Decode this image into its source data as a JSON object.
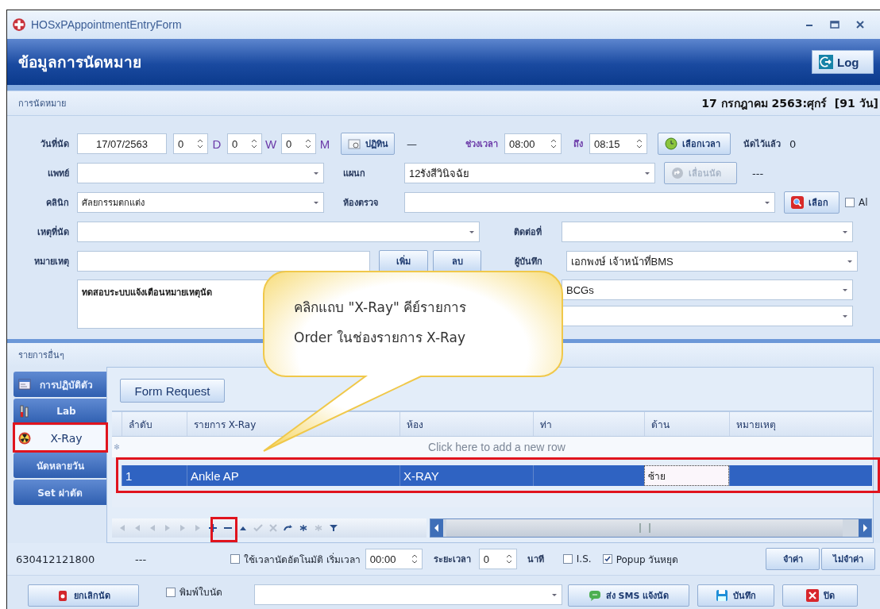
{
  "window": {
    "title": "HOSxPAppointmentEntryForm"
  },
  "header": {
    "title": "ข้อมูลการนัดหมาย",
    "log_button": "Log"
  },
  "appointment": {
    "group_title": "การนัดหมาย",
    "date_summary": "17 กรกฎาคม 2563:ศุกร์  [91 วัน]",
    "date_label": "วันที่นัด",
    "date": "17/07/2563",
    "offsets": [
      {
        "value": "0",
        "unit": "D"
      },
      {
        "value": "0",
        "unit": "W"
      },
      {
        "value": "0",
        "unit": "M"
      }
    ],
    "calendar_button": "ปฏิทิน",
    "dash": "—",
    "time_label": "ช่วงเวลา",
    "time_from": "08:00",
    "to_label": "ถึง",
    "time_to": "08:15",
    "pick_time_button": {
      "label": "เลือกเวลา",
      "disabled": false
    },
    "booked_label": "นัดไว้แล้ว",
    "booked_count": "0",
    "doctor_label": "แพทย์",
    "department_label": "แผนก",
    "department": "12รังสีวินิจฉัย",
    "postpone_button": {
      "label": "เลื่อนนัด",
      "disabled": true
    },
    "postpone_info": "---",
    "clinic_label": "คลินิก",
    "clinic": "ศัลยกรรมตกแต่ง",
    "room_label": "ห้องตรวจ",
    "select_button": "เลือก",
    "all_checkbox": {
      "label": "Al",
      "checked": false
    },
    "reason_label": "เหตุที่นัด",
    "contact_label": "ติดต่อที่",
    "note_label": "หมายเหตุ",
    "add_button": "เพิ่ม",
    "delete_button": "ลบ",
    "recorder_label": "ผู้บันทึก",
    "recorder": "เอกพงษ์ เจ้าหน้าที่BMS",
    "memo": "ทดสอบระบบแจ้งเตือนหมายเหตุนัด",
    "extra_combo": "BCGs"
  },
  "others": {
    "group_title": "รายการอื่นๆ",
    "tabs": [
      {
        "label": "การปฏิบัติตัว",
        "selected": false
      },
      {
        "label": "Lab",
        "selected": false
      },
      {
        "label": "X-Ray",
        "selected": true
      },
      {
        "label": "นัดหลายวัน",
        "selected": false
      },
      {
        "label": "Set ผ่าตัด",
        "selected": false
      }
    ],
    "form_request_button": "Form Request",
    "columns": [
      "ลำดับ",
      "รายการ X-Ray",
      "ห้อง",
      "ท่า",
      "ด้าน",
      "หมายเหตุ"
    ],
    "new_row_marker": "✻",
    "new_row_hint": "Click here to add a new row",
    "rows": [
      {
        "no": "1",
        "item": "Ankle AP",
        "room": "X-RAY",
        "side": "ซ้าย",
        "selected": true
      }
    ]
  },
  "bottom": {
    "hn": "630412121800",
    "hn_info": "---",
    "auto_time": {
      "label": "ใช้เวลานัดอัตโนมัติ เริ่มเวลา",
      "checked": false
    },
    "start_time": "00:00",
    "duration_label": "ระยะเวลา",
    "duration": "0",
    "minutes_label": "นาที",
    "is_checkbox": {
      "label": "I.S.",
      "checked": false
    },
    "popup_checkbox": {
      "label": "Popup วันหยุด",
      "checked": true
    },
    "remember_button": "จำค่า",
    "forget_button": "ไม่จำค่า"
  },
  "actions": {
    "cancel_button": "ยกเลิกนัด",
    "print_checkbox": {
      "label": "พิมพ์ใบนัด",
      "checked": false
    },
    "sms_button": "ส่ง SMS แจ้งนัด",
    "save_button": "บันทึก",
    "close_button": "ปิด"
  },
  "callout": {
    "lines": [
      "คลิกแถบ \"X-Ray\" คีย์รายการ",
      "Order ในช่องรายการ X-Ray"
    ]
  }
}
